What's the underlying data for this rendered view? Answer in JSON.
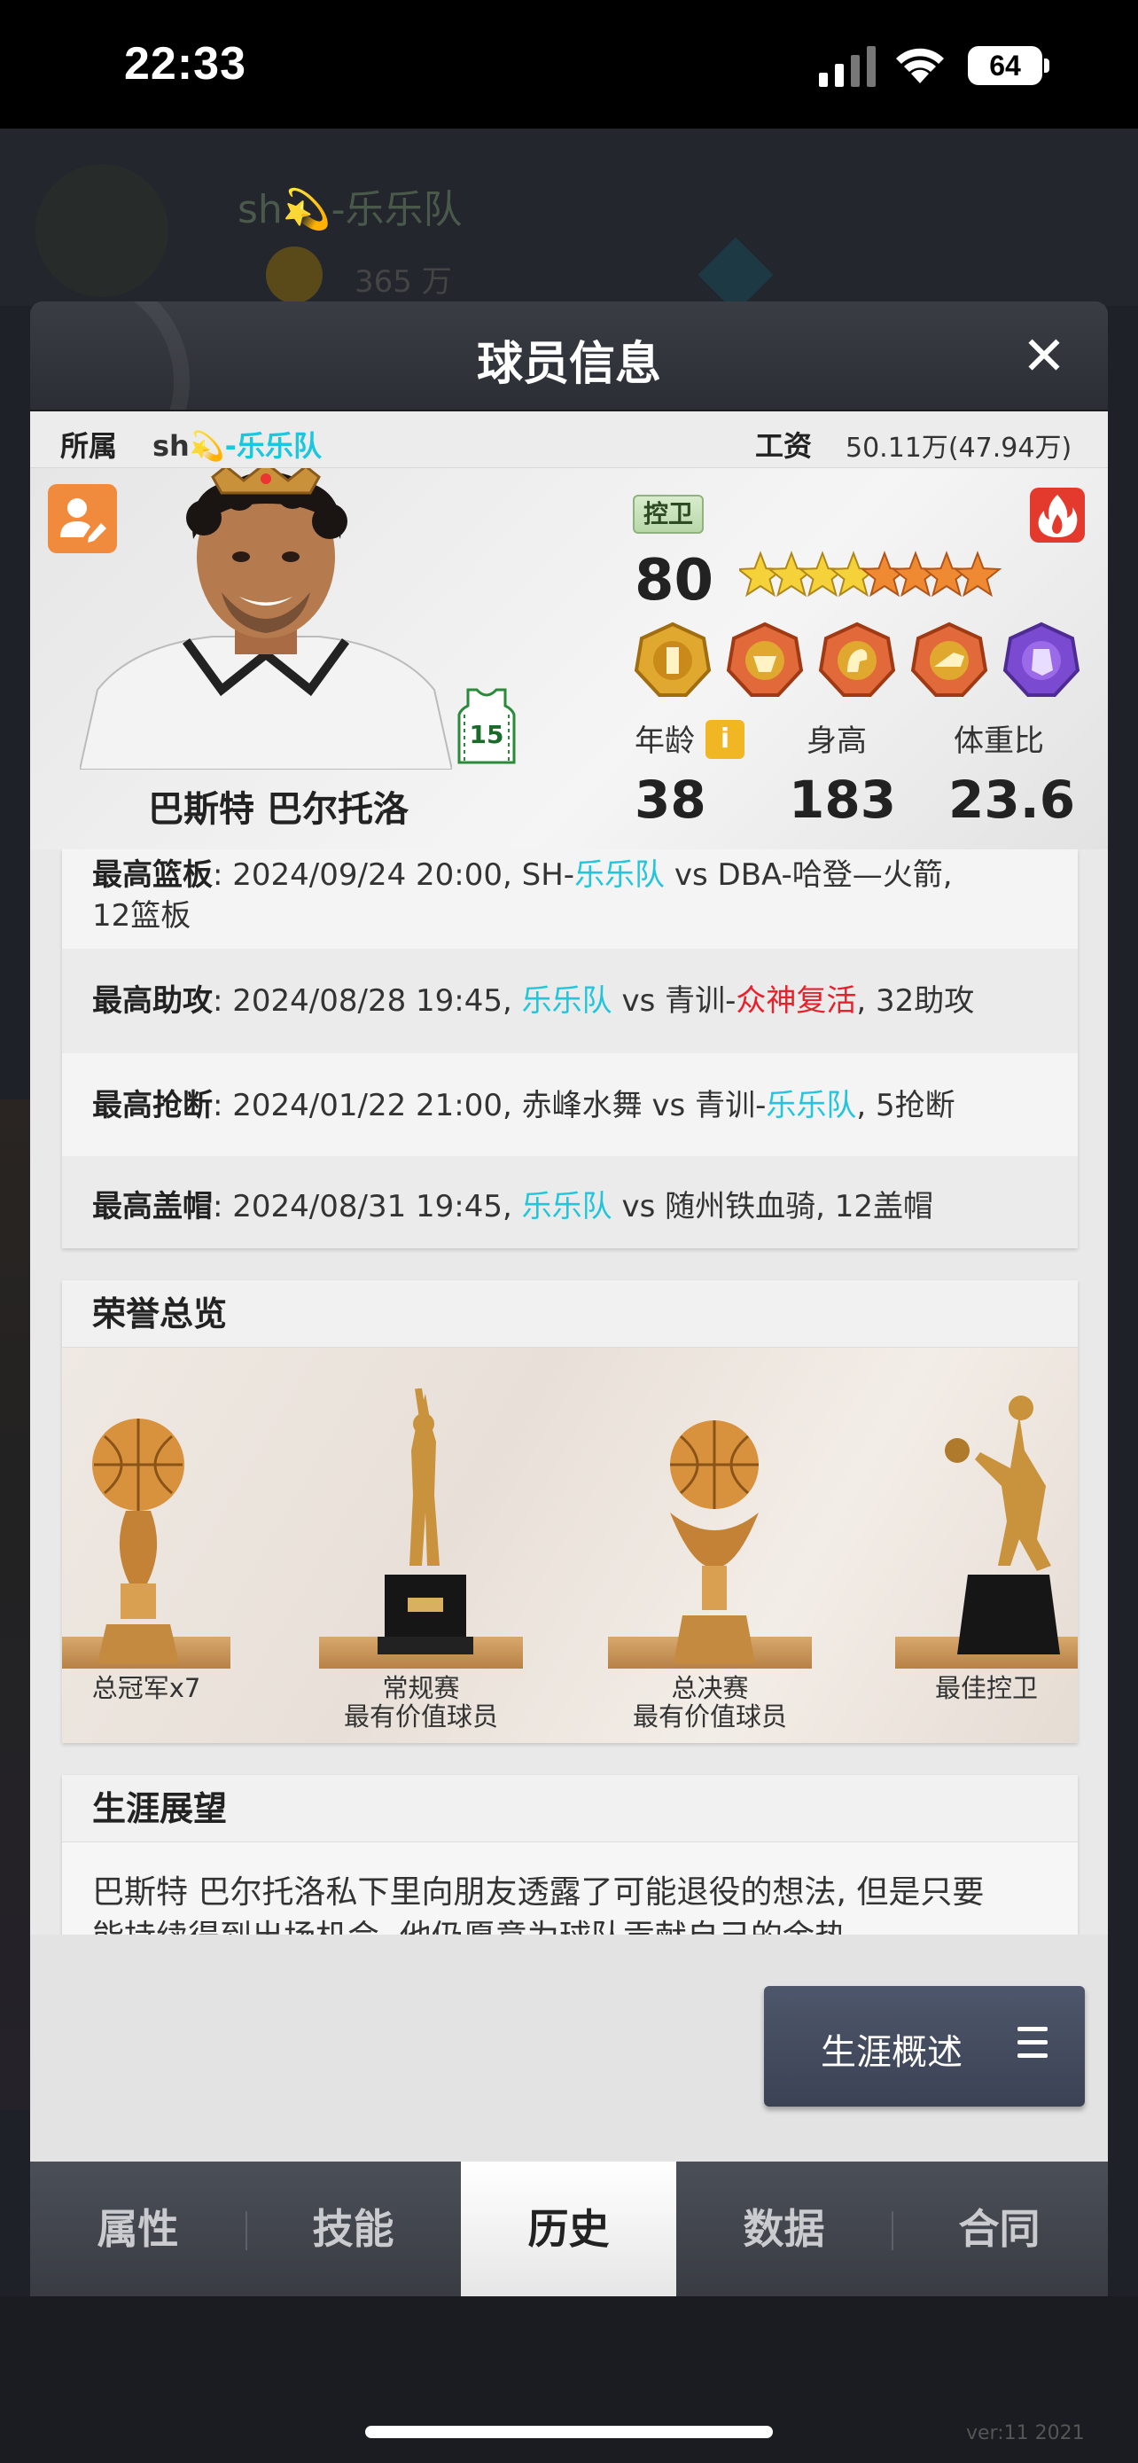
{
  "status_bar": {
    "time": "22:33",
    "battery": "64"
  },
  "modal": {
    "title": "球员信息",
    "close": "✕"
  },
  "affiliation": {
    "label": "所属",
    "team_prefix": "sh",
    "team_name": "-乐乐队",
    "salary_label": "工资",
    "salary_value": "50.11万(47.94万)"
  },
  "player": {
    "name": "巴斯特 巴尔托洛",
    "jersey_number": "15",
    "position": "控卫",
    "overall": "80",
    "stars": 8,
    "age_label": "年龄",
    "age": "38",
    "height_label": "身高",
    "height": "183",
    "weight_ratio_label": "体重比",
    "weight_ratio": "23.6",
    "info_icon": "i"
  },
  "records": [
    {
      "title": "最高篮板",
      "text": ": 2024/09/24 20:00, SH-",
      "team": "乐乐队",
      "rest": " vs DBA-哈登—火箭,",
      "line2": "12篮板"
    },
    {
      "title": "最高助攻",
      "text": ": 2024/08/28 19:45, ",
      "team": "乐乐队",
      "mid": " vs 青训-",
      "red": "众神复活",
      "rest": ", 32助攻"
    },
    {
      "title": "最高抢断",
      "text": ": 2024/01/22 21:00, 赤峰水舞 vs 青训-",
      "team": "乐乐队",
      "rest": ", 5抢断"
    },
    {
      "title": "最高盖帽",
      "text": ": 2024/08/31 19:45, ",
      "team": "乐乐队",
      "rest": " vs 随州铁血骑, 12盖帽"
    }
  ],
  "honors": {
    "title": "荣誉总览",
    "items": [
      {
        "line1": "总冠军x7",
        "line2": ""
      },
      {
        "line1": "常规赛",
        "line2": "最有价值球员"
      },
      {
        "line1": "总决赛",
        "line2": "最有价值球员"
      },
      {
        "line1": "最佳控卫",
        "line2": ""
      }
    ]
  },
  "career": {
    "title": "生涯展望",
    "line1": "巴斯特 巴尔托洛私下里向朋友透露了可能退役的想法, 但是只要",
    "line2": "能持续得到出场机会, 他仍愿意为球队贡献自己的余热"
  },
  "career_button": {
    "label": "生涯概述"
  },
  "tabs": [
    "属性",
    "技能",
    "历史",
    "数据",
    "合同"
  ],
  "active_tab": "历史",
  "version": "ver:11  2021",
  "colors": {
    "accent_cyan": "#1bc7e0",
    "accent_red": "#e8202c",
    "edit_orange": "#f08a3c",
    "fire_red": "#e33a2d"
  }
}
